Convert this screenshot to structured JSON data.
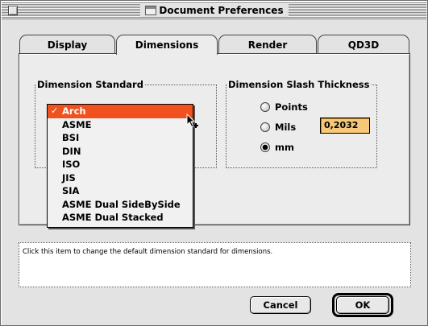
{
  "window": {
    "title": "Document Preferences"
  },
  "tabs": [
    {
      "label": "Display"
    },
    {
      "label": "Dimensions"
    },
    {
      "label": "Render"
    },
    {
      "label": "QD3D"
    }
  ],
  "dimension_standard": {
    "title": "Dimension Standard",
    "selected": "Arch",
    "options": [
      "Arch",
      "ASME",
      "BSI",
      "DIN",
      "ISO",
      "JIS",
      "SIA",
      "ASME Dual SideBySide",
      "ASME Dual Stacked"
    ],
    "check_mark": "✓"
  },
  "slash_thickness": {
    "title": "Dimension Slash Thickness",
    "options": [
      {
        "label": "Points",
        "checked": false
      },
      {
        "label": "Mils",
        "checked": false
      },
      {
        "label": "mm",
        "checked": true
      }
    ],
    "value": "0,2032"
  },
  "help_text": "Click this item to change the default dimension standard for dimensions.",
  "buttons": {
    "cancel": "Cancel",
    "ok": "OK"
  },
  "colors": {
    "highlight": "#f0511f",
    "value_field": "#f5c87a"
  }
}
